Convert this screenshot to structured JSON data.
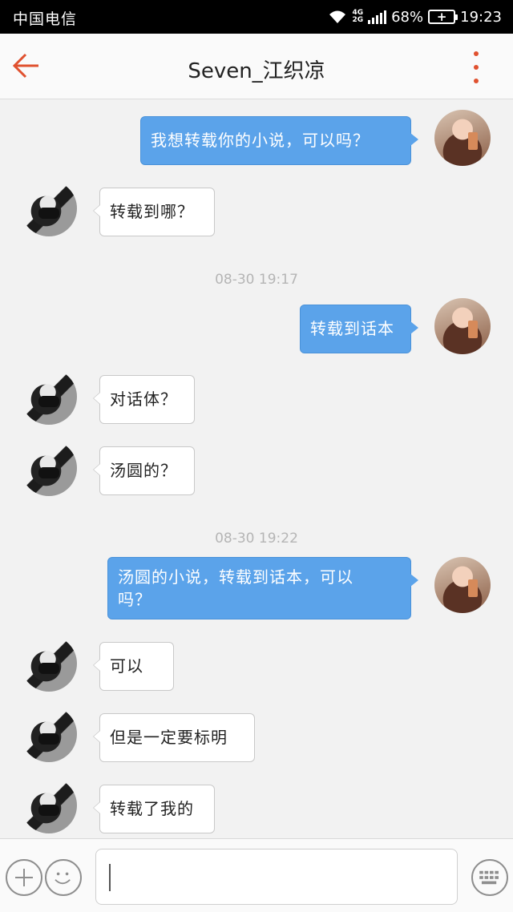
{
  "status_bar": {
    "carrier": "中国电信",
    "network_top": "4G",
    "network_bottom": "2G",
    "battery_percent": "68%",
    "time": "19:23"
  },
  "header": {
    "title": "Seven_江织凉"
  },
  "messages": [
    {
      "sender": "me",
      "text": "我想转载你的小说，可以吗？"
    },
    {
      "sender": "other",
      "text": "转载到哪？"
    },
    {
      "timestamp": "08-30 19:17"
    },
    {
      "sender": "me",
      "text": "转载到话本"
    },
    {
      "sender": "other",
      "text": "对话体？"
    },
    {
      "sender": "other",
      "text": "汤圆的？"
    },
    {
      "timestamp": "08-30 19:22"
    },
    {
      "sender": "me",
      "text_line1": "汤圆的小说，转载到话本，可以",
      "text_line2": "吗？"
    },
    {
      "sender": "other",
      "text": "可以"
    },
    {
      "sender": "other",
      "text": "但是一定要标明"
    },
    {
      "sender": "other",
      "text": "转载了我的"
    }
  ],
  "colors": {
    "accent": "#e0512f",
    "outgoing_bubble": "#5ba3ea",
    "incoming_bubble": "#ffffff"
  }
}
